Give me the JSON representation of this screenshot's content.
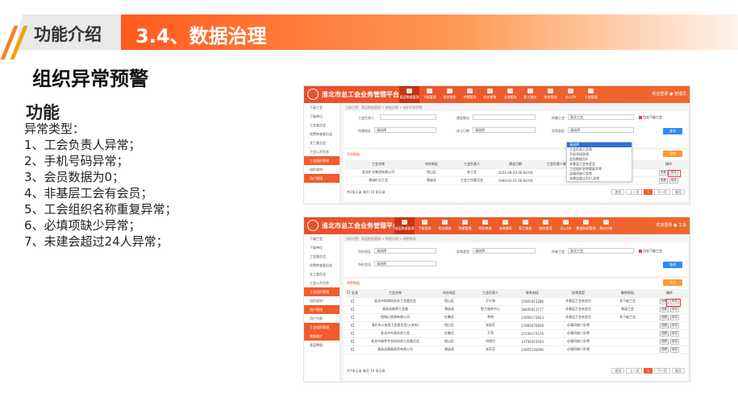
{
  "slide": {
    "tag": "功能介绍",
    "section": "3.4、数据治理",
    "title": "组织异常预警",
    "func_head": "功能",
    "func_lines": [
      "异常类型：",
      "1、工会负责人异常；",
      "2、手机号码异常；",
      "3、会员数据为0；",
      "4、非基层工会有会员；",
      "5、工会组织名称重复异常；",
      "6、必填项缺少异常；",
      "7、未建会超过24人异常；"
    ]
  },
  "app": {
    "title": "淮北市总工会业务管理平台",
    "nav": [
      "基层数据管理",
      "下级管理",
      "帮扶救助",
      "劳模管理",
      "四史教育",
      "法律援助",
      "职工服务",
      "财务管理",
      "办公OA",
      "干部管理"
    ],
    "nav2": [
      "基层数据管理",
      "下级管理",
      "帮扶救助",
      "劳模管理",
      "四史教育",
      "法律援助",
      "职工服务",
      "财务管理",
      "办公OA",
      "数据科研管理",
      "统计分析"
    ],
    "user1": "欢迎登录",
    "user2": "管理员",
    "user2b": "工会"
  },
  "s1": {
    "breadcrumb": "当前位置：基层数据管理 > 数据治理 > 组织异常预警",
    "side": [
      "下级工会",
      "下级单位",
      "工会委员会",
      "经费审查委员会",
      "女工委员会",
      "工会公开信息",
      "工会组织管理",
      "组织架构",
      "用户管理"
    ],
    "f_leader": "工会负责人",
    "f_name": "建会情况",
    "f_union_lbl": "所属工会",
    "f_union": "淮北工会",
    "check": "包含下级工会",
    "f_region_lbl": "所属地区",
    "f_region": "请选择",
    "f_found_lbl": "成立日期",
    "f_found": "请选择",
    "f_type_lbl": "异常类型",
    "f_type": "请选择",
    "search": "查询",
    "export": "导出",
    "section": "异常数据",
    "cols": [
      "工会名称",
      "所在地区",
      "工会负责人",
      "建会日期",
      "工会负责人联系电话",
      "异常类型",
      "操作"
    ],
    "rows": [
      [
        "淮北矿业集团有限公司",
        "相山区",
        "苏工会",
        "2021-09-24 00:00:00",
        "",
        "会员数据为0"
      ],
      [
        "濉溪矿业工会",
        "濉溪县",
        "工会工作委员会",
        "1994-01-01 00:00:00",
        "",
        "非基层工会有会员"
      ]
    ],
    "ops": [
      "查看",
      "核实"
    ],
    "dropdown": [
      "请选择",
      "工会负责人异常",
      "手机号码异常",
      "会员数据为0",
      "非基层工会有会员",
      "工会组织名称重复异常",
      "必填项缺少异常",
      "未建会超过24人异常"
    ],
    "total": "共2条记录  每页 10 条记录",
    "pager": [
      "首页",
      "上一页",
      "1",
      "下一页",
      "尾页"
    ]
  },
  "s2": {
    "breadcrumb": "当前位置：基层数据管理 > 数据治理 > 预警数据",
    "side": [
      "下级工会",
      "下级单位",
      "工会委员会",
      "经费审查委员会",
      "女工委员会",
      "工会公开信息",
      "工会组织管理",
      "组织架构",
      "用户管理",
      "用户列表",
      "工会组织管理",
      "数据维护",
      "基层数据"
    ],
    "f_region_lbl": "所在地区",
    "f_region": "请选择",
    "f_type_lbl": "异常类型",
    "f_type": "请选择",
    "f_union_lbl": "所属工会",
    "f_union": "淮北工会",
    "check": "包含下级工会",
    "f_name_lbl": "所在会员",
    "f_name": "请选择",
    "search": "查询",
    "export": "导出",
    "section": "预警数据",
    "cols": [
      "全选",
      "工会名称",
      "所在地区",
      "工会负责人",
      "联系电话",
      "异常类型",
      "解除原因",
      "操作"
    ],
    "rows": [
      [
        "淮北市财政局机关工会委员会",
        "相山区",
        "尹大海",
        "15905615286",
        "非基层工会有会员",
        "非下级工会"
      ],
      [
        "濉溪县烟草工会委",
        "濉溪县",
        "职工服务中心",
        "18405611777",
        "非基层工会有会员",
        "濉溪工会"
      ],
      [
        "相城山泉源有限公司",
        "杜集区",
        "李明",
        "13956172823",
        "非基层工会有会员",
        "非下级工会"
      ],
      [
        "淮北市公安局工会委员会(公安处)",
        "相山区",
        "张丽芳",
        "13905670858",
        "必填项缺少异常",
        ""
      ],
      [
        "淮北市市直机关工会",
        "杜集区",
        "王萍",
        "15156172576",
        "必填项缺少异常",
        ""
      ],
      [
        "淮北市烟草专卖局机关工会委员会",
        "相山区",
        "刘明月",
        "13756415044",
        "必填项缺少异常",
        ""
      ],
      [
        "濉溪县康泰医药有限公司",
        "濉溪县",
        "张芳芳",
        "13955130096",
        "必填项缺少异常",
        ""
      ]
    ],
    "ops": [
      "查看",
      "核实"
    ],
    "total": "共7条记录  每页 10 条记录",
    "pager": [
      "首页",
      "上一页",
      "1",
      "下一页",
      "尾页"
    ]
  }
}
